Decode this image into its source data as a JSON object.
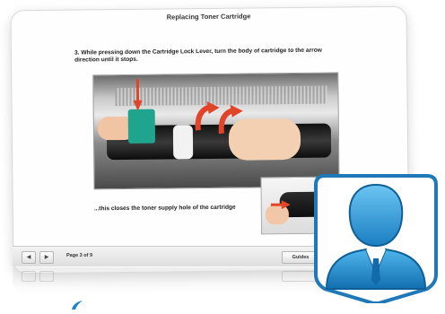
{
  "window": {
    "title": "Replacing Toner Cartridge",
    "step_text": "3. While pressing down the Cartridge Lock Lever, turn the body of cartridge to the arrow direction until it stops.",
    "caption": "...this closes the toner supply hole of the cartridge"
  },
  "navbar": {
    "prev_label": "◀",
    "next_label": "▶",
    "page_label": "Page 3 of 9",
    "guides_label": "Guides"
  },
  "colors": {
    "accent_blue": "#1f86c8",
    "lever_green": "#1fa58e",
    "arrow_red": "#e0452a"
  }
}
